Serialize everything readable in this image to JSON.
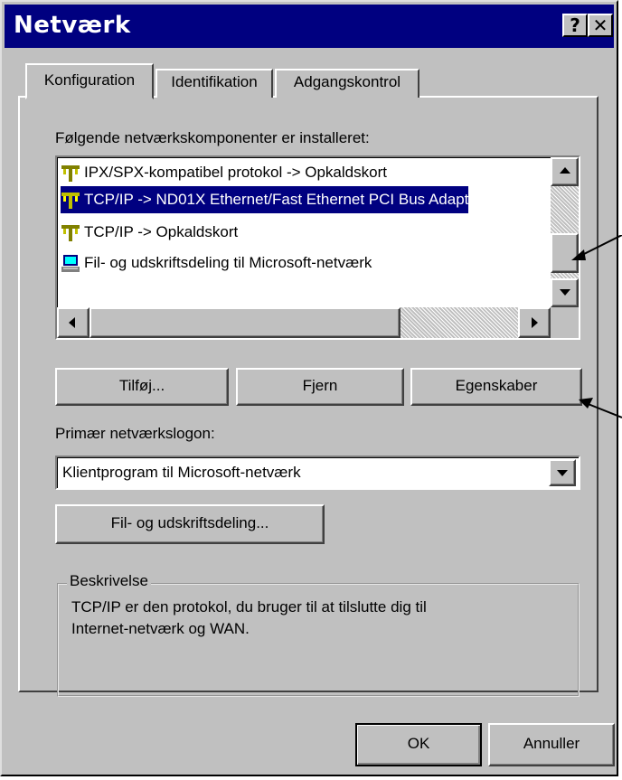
{
  "window": {
    "title": "Netværk",
    "help_glyph": "?",
    "close_glyph": "✕"
  },
  "tabs": [
    {
      "label": "Konfiguration"
    },
    {
      "label": "Identifikation"
    },
    {
      "label": "Adgangskontrol"
    }
  ],
  "components": {
    "label": "Følgende netværkskomponenter er installeret:",
    "items": [
      {
        "label": "IPX/SPX-kompatibel protokol -> Opkaldskort",
        "icon": "network-protocol-icon",
        "selected": false
      },
      {
        "label": "TCP/IP -> ND01X Ethernet/Fast Ethernet PCI Bus Adapt",
        "icon": "network-protocol-icon",
        "selected": true
      },
      {
        "label": "TCP/IP -> Opkaldskort",
        "icon": "network-protocol-icon",
        "selected": false
      },
      {
        "label": "Fil- og udskriftsdeling til Microsoft-netværk",
        "icon": "file-print-sharing-icon",
        "selected": false
      }
    ]
  },
  "buttons": {
    "add": "Tilføj...",
    "remove": "Fjern",
    "properties": "Egenskaber",
    "file_print_sharing": "Fil- og udskriftsdeling...",
    "ok": "OK",
    "cancel": "Annuller"
  },
  "logon": {
    "label": "Primær netværkslogon:",
    "value": "Klientprogram til Microsoft-netværk"
  },
  "description": {
    "legend": "Beskrivelse",
    "text_line1": "TCP/IP er den protokol, du bruger til at tilslutte dig til",
    "text_line2": "Internet-netværk og WAN."
  }
}
